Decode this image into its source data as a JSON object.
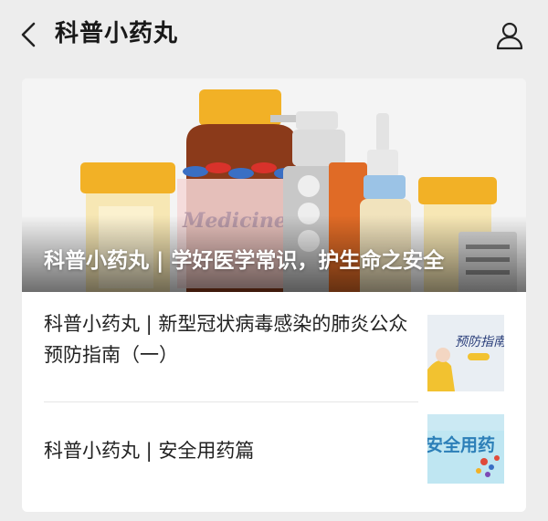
{
  "header": {
    "title": "科普小药丸",
    "back_icon": "chevron-left-icon",
    "profile_icon": "user-icon"
  },
  "hero": {
    "title": "科普小药丸 | 学好医学常识，护生命之安全",
    "image_label": "Medicine"
  },
  "articles": [
    {
      "title": "科普小药丸 | 新型冠状病毒感染的肺炎公众预防指南（一）",
      "thumb_text": "预防指南"
    },
    {
      "title": "科普小药丸 | 安全用药篇",
      "thumb_text": "安全用药"
    }
  ],
  "colors": {
    "background": "#ededed",
    "card": "#ffffff",
    "bottle_cap": "#f2b126",
    "bottle_brown": "#8b3a1a",
    "pill_blue": "#3a6fc4",
    "pill_red": "#d9322b"
  }
}
